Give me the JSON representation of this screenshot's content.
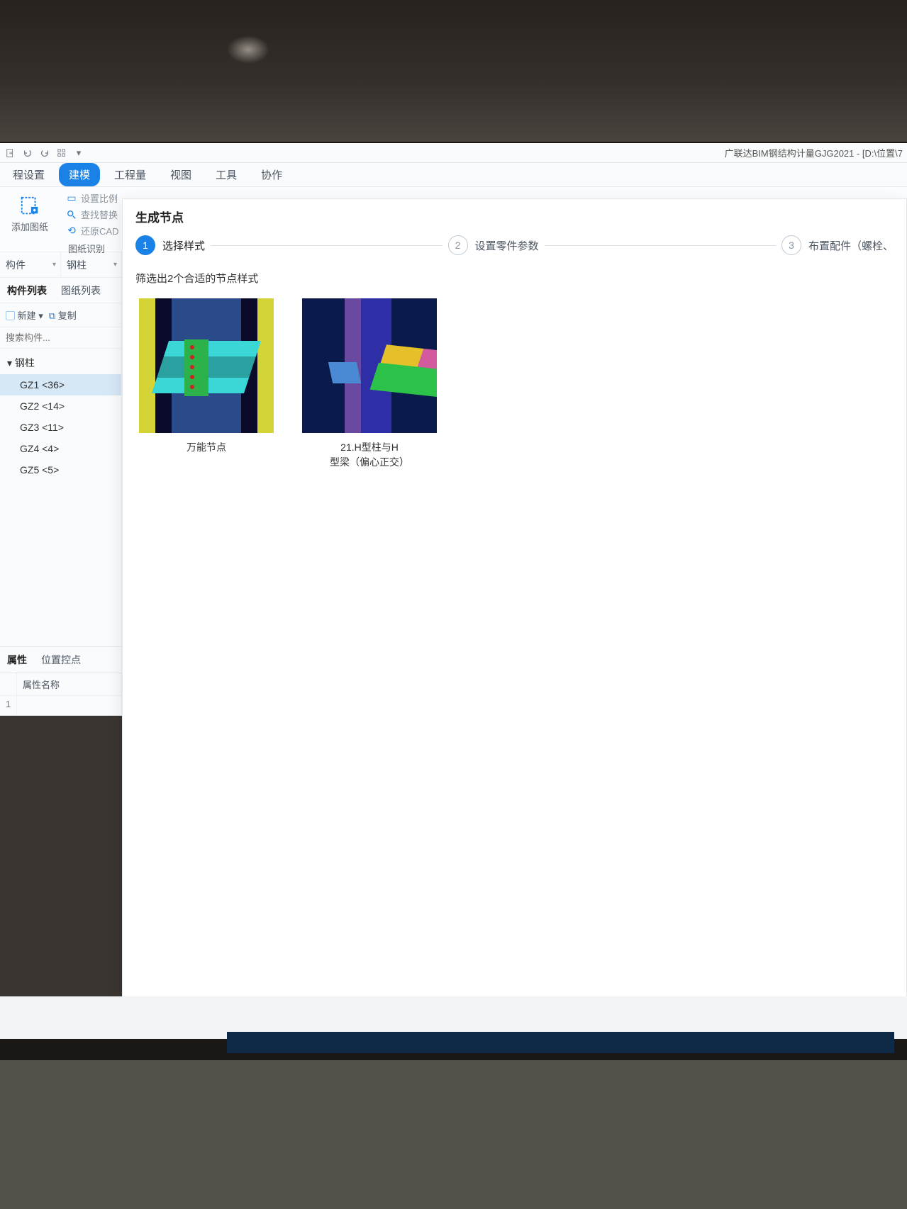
{
  "app": {
    "title": "广联达BIM钢结构计量GJG2021 - [D:\\位置\\7"
  },
  "qat": {
    "new": "new",
    "undo": "undo",
    "redo": "redo",
    "grid": "grid"
  },
  "menus": [
    "程设置",
    "建模",
    "工程量",
    "视图",
    "工具",
    "协作"
  ],
  "menu_active_index": 1,
  "ribbon": {
    "add_drawing": "添加图纸",
    "set_scale": "设置比例",
    "find_replace": "查找替换",
    "restore_cad": "还原CAD",
    "drawing_label": "图纸识别"
  },
  "left": {
    "type_a": "构件",
    "type_b": "钢柱",
    "tabs": [
      "构件列表",
      "图纸列表"
    ],
    "tab_active": 0,
    "new_btn": "新建",
    "copy_btn": "复制",
    "search_placeholder": "搜索构件...",
    "tree_root": "钢柱",
    "tree_items": [
      "GZ1 <36>",
      "GZ2 <14>",
      "GZ3 <11>",
      "GZ4 <4>",
      "GZ5 <5>"
    ],
    "tree_selected": 0,
    "props_tabs": [
      "属性",
      "位置控点"
    ],
    "props_col": "属性名称",
    "props_row_num": "1"
  },
  "modal": {
    "title": "生成节点",
    "steps": [
      "选择样式",
      "设置零件参数",
      "布置配件（螺栓、"
    ],
    "step_active": 0,
    "filter_text": "筛选出2个合适的节点样式",
    "thumbs": [
      {
        "label": "万能节点"
      },
      {
        "label": "21.H型柱与H\n型梁（偏心正交）"
      }
    ]
  }
}
